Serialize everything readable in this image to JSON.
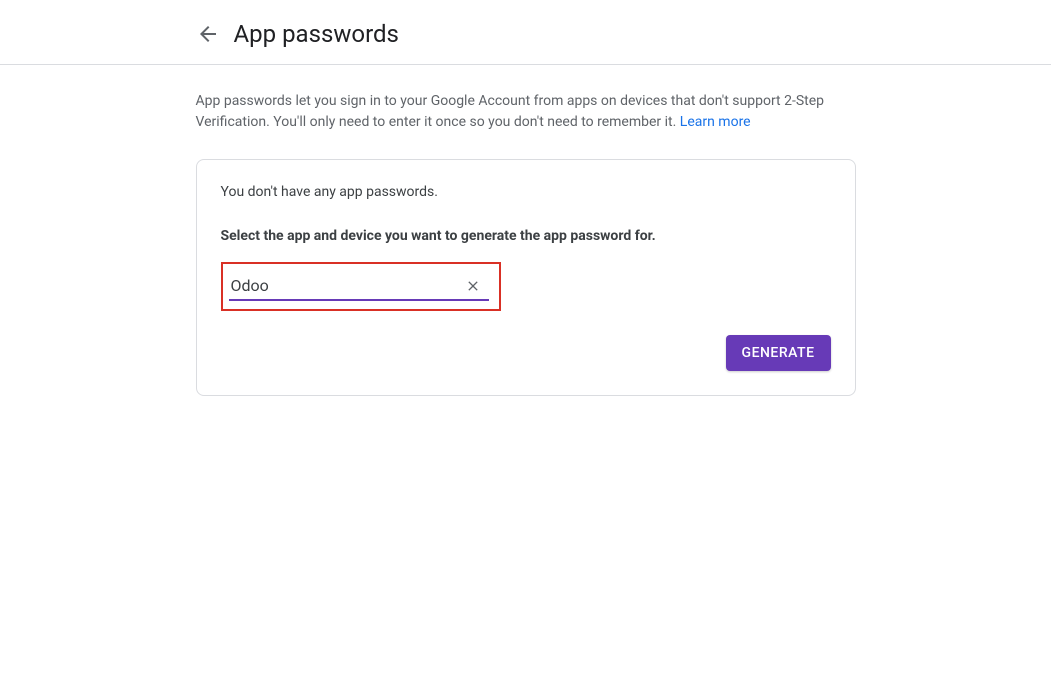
{
  "header": {
    "title": "App passwords"
  },
  "description": {
    "text": "App passwords let you sign in to your Google Account from apps on devices that don't support 2-Step Verification. You'll only need to enter it once so you don't need to remember it. ",
    "learn_more": "Learn more"
  },
  "card": {
    "empty_message": "You don't have any app passwords.",
    "select_prompt": "Select the app and device you want to generate the app password for.",
    "input_value": "Odoo",
    "generate_label": "GENERATE"
  }
}
